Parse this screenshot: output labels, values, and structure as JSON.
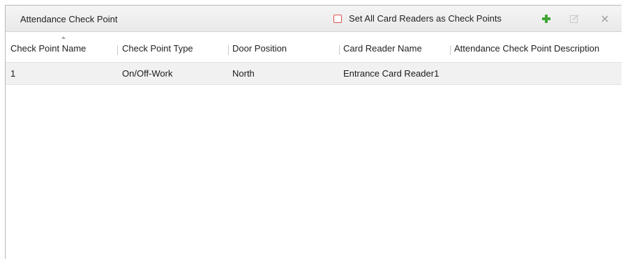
{
  "panel": {
    "title": "Attendance Check Point",
    "set_all_label": "Set All Card Readers as Check Points",
    "set_all_checked": false
  },
  "toolbar": {
    "add_icon": "plus-icon",
    "edit_icon": "edit-icon",
    "delete_icon": "close-icon",
    "add_color": "#3fa535"
  },
  "table": {
    "columns": [
      "Check Point Name",
      "Check Point Type",
      "Door Position",
      "Card Reader Name",
      "Attendance Check Point Description"
    ],
    "rows": [
      [
        "1",
        "On/Off-Work",
        "North",
        "Entrance Card Reader1",
        ""
      ]
    ]
  }
}
